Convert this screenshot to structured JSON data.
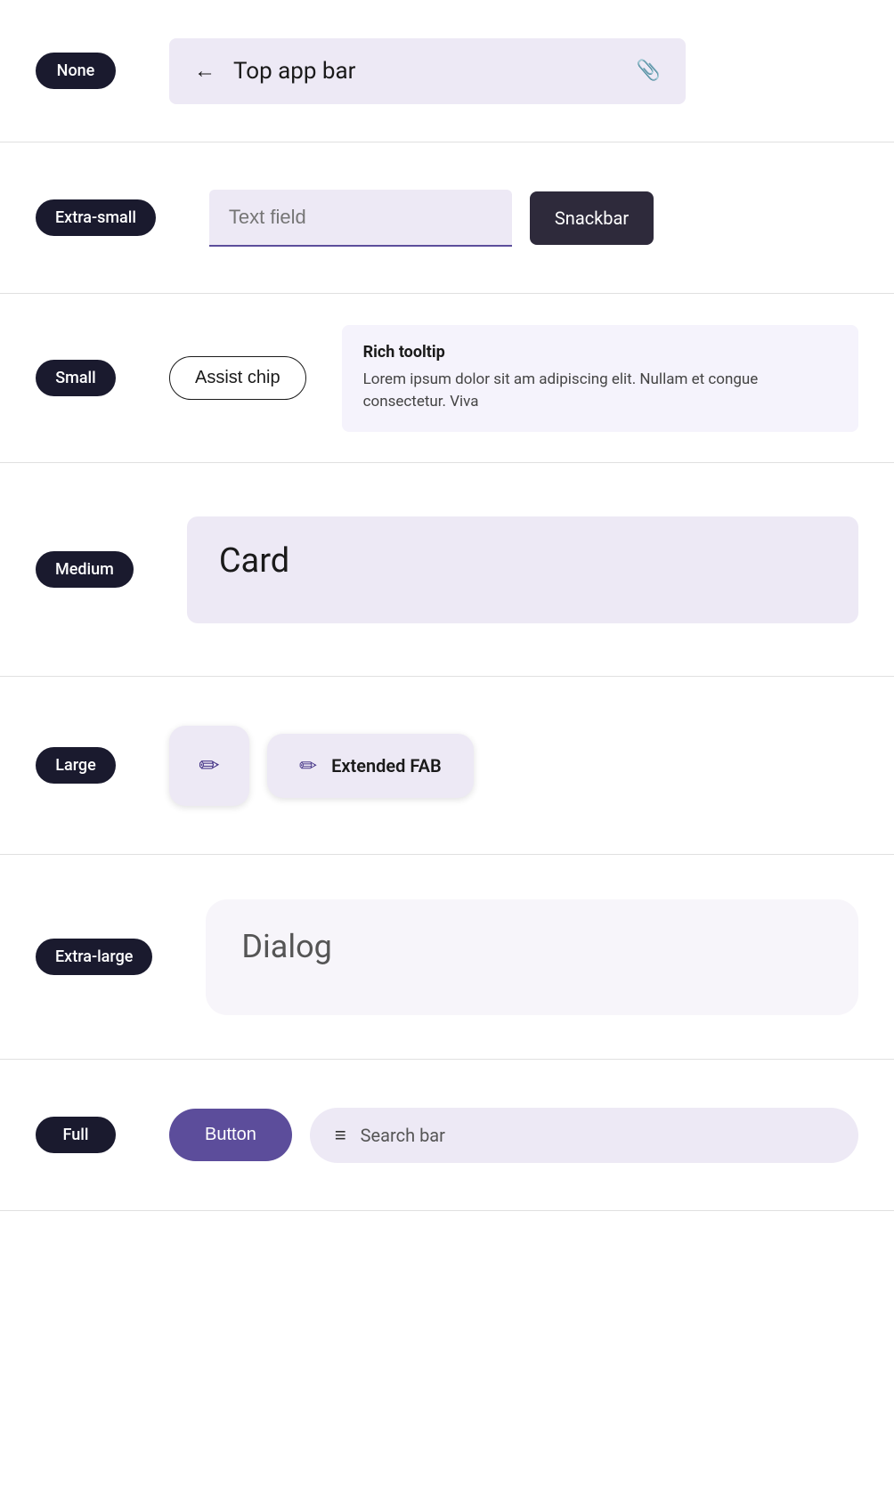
{
  "rows": {
    "none": {
      "badge": "None",
      "topAppBar": {
        "backIcon": "←",
        "title": "Top app bar",
        "attachIcon": "📎"
      }
    },
    "extraSmall": {
      "badge": "Extra-small",
      "textField": {
        "placeholder": "Text field"
      },
      "snackbar": {
        "label": "Snackbar"
      }
    },
    "small": {
      "badge": "Small",
      "assistChip": {
        "label": "Assist chip"
      },
      "richTooltip": {
        "title": "Rich tooltip",
        "body": "Lorem ipsum dolor sit am adipiscing elit. Nullam et congue consectetur. Viva"
      }
    },
    "medium": {
      "badge": "Medium",
      "card": {
        "title": "Card"
      }
    },
    "large": {
      "badge": "Large",
      "fab": {
        "pencilIcon": "✏"
      },
      "extendedFab": {
        "pencilIcon": "✏",
        "label": "Extended FAB"
      }
    },
    "extraLarge": {
      "badge": "Extra-large",
      "dialog": {
        "title": "Dialog"
      }
    },
    "full": {
      "badge": "Full",
      "button": {
        "label": "Button"
      },
      "searchBar": {
        "menuIcon": "≡",
        "placeholder": "Search bar"
      }
    }
  }
}
